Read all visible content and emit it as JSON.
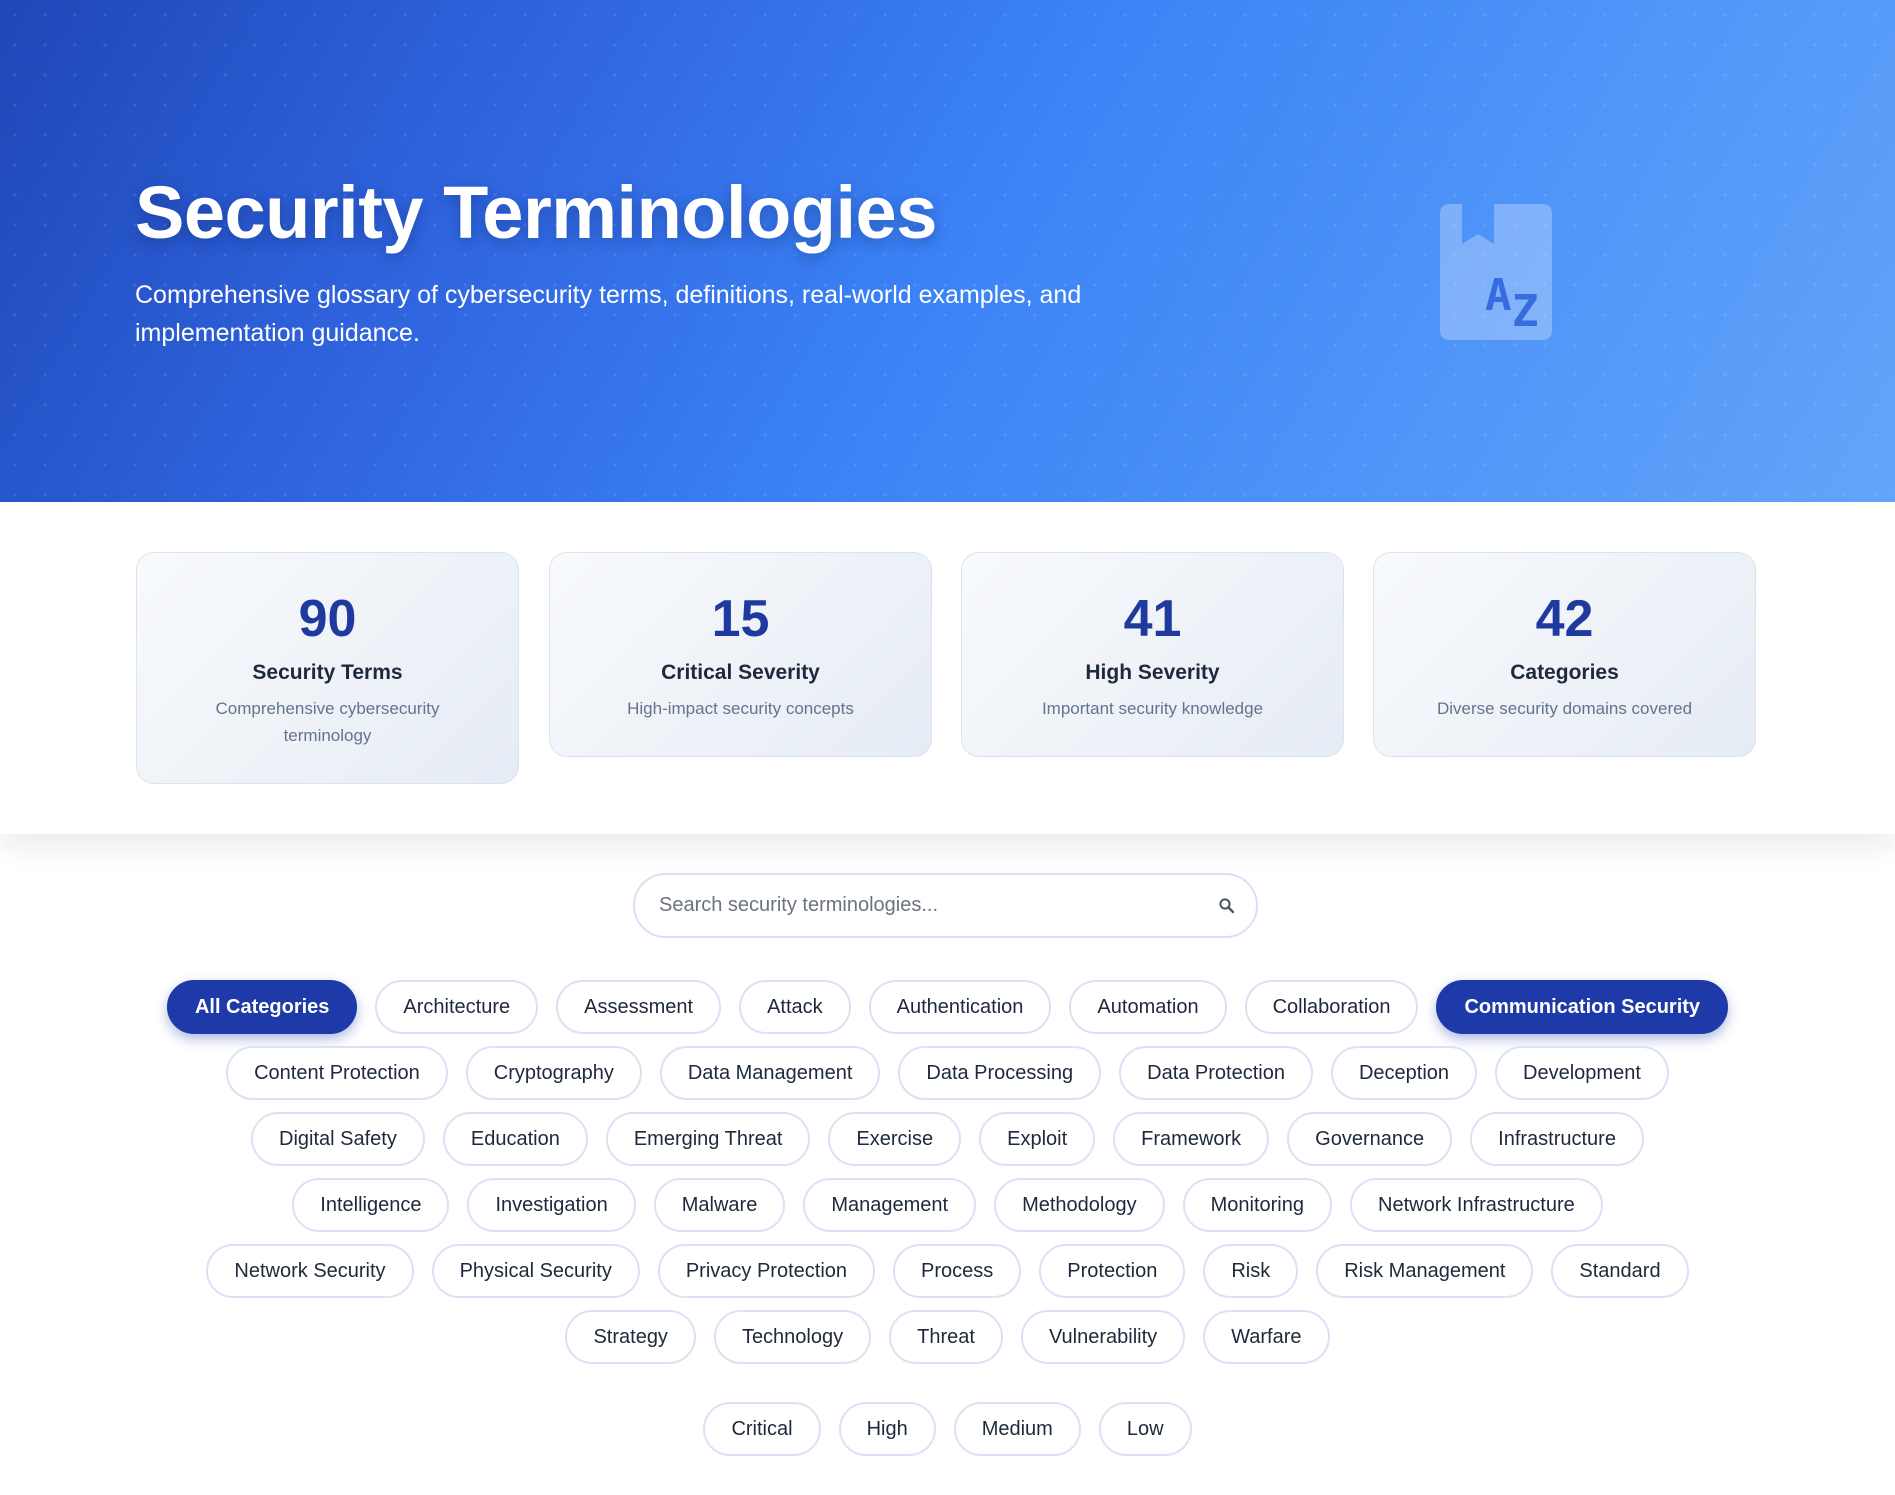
{
  "hero": {
    "title": "Security Terminologies",
    "subtitle": "Comprehensive glossary of cybersecurity terms, definitions, real-world examples, and implementation guidance.",
    "icon": "book-az-icon"
  },
  "stats": [
    {
      "value": "90",
      "label": "Security Terms",
      "description": "Comprehensive cybersecurity terminology"
    },
    {
      "value": "15",
      "label": "Critical Severity",
      "description": "High-impact security concepts"
    },
    {
      "value": "41",
      "label": "High Severity",
      "description": "Important security knowledge"
    },
    {
      "value": "42",
      "label": "Categories",
      "description": "Diverse security domains covered"
    }
  ],
  "search": {
    "placeholder": "Search security terminologies...",
    "value": "",
    "icon": "search-icon"
  },
  "categories": [
    "All Categories",
    "Architecture",
    "Assessment",
    "Attack",
    "Authentication",
    "Automation",
    "Collaboration",
    "Communication Security",
    "Content Protection",
    "Cryptography",
    "Data Management",
    "Data Processing",
    "Data Protection",
    "Deception",
    "Development",
    "Digital Safety",
    "Education",
    "Emerging Threat",
    "Exercise",
    "Exploit",
    "Framework",
    "Governance",
    "Infrastructure",
    "Intelligence",
    "Investigation",
    "Malware",
    "Management",
    "Methodology",
    "Monitoring",
    "Network Infrastructure",
    "Network Security",
    "Physical Security",
    "Privacy Protection",
    "Process",
    "Protection",
    "Risk",
    "Risk Management",
    "Standard",
    "Strategy",
    "Technology",
    "Threat",
    "Vulnerability",
    "Warfare"
  ],
  "active_categories": [
    "All Categories",
    "Communication Security"
  ],
  "severities": [
    "Critical",
    "High",
    "Medium",
    "Low"
  ],
  "colors": {
    "accent": "#1e3aa8",
    "stat_number": "#1e3a9e",
    "hero_start": "#1f47b8",
    "hero_end": "#62a5fa"
  }
}
